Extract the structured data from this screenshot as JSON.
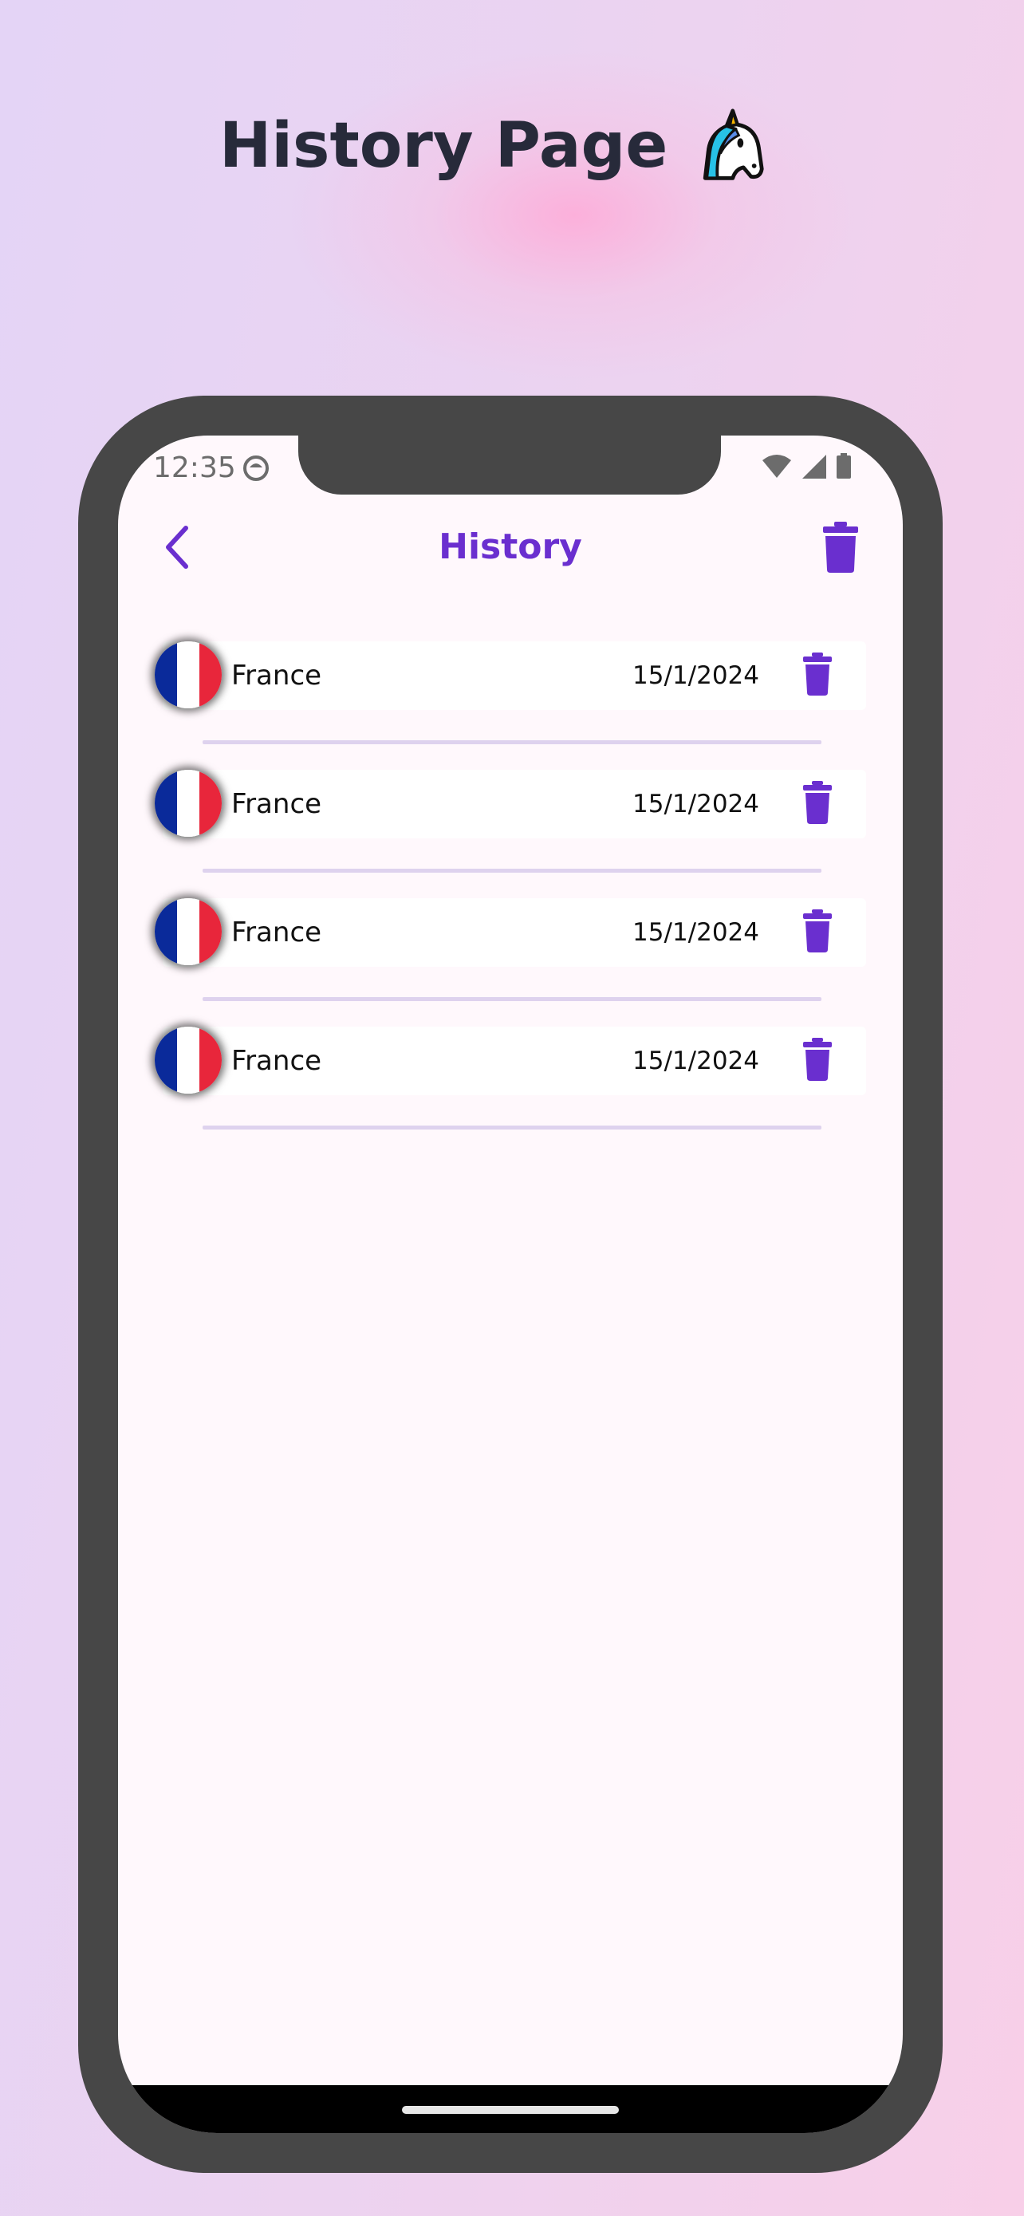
{
  "headline": {
    "text": "History Page",
    "emoji_icon": "unicorn-icon"
  },
  "status_bar": {
    "time": "12:35"
  },
  "app_bar": {
    "title": "History",
    "back_icon": "chevron-left-icon",
    "clear_icon": "trash-icon"
  },
  "colors": {
    "accent": "#6a2fcf",
    "frame": "#474747",
    "screen_bg": "#fff8fc",
    "divider": "#ded2ee"
  },
  "history": [
    {
      "country": "France",
      "date": "15/1/2024",
      "flag": [
        "#0a2a9a",
        "#ffffff",
        "#e8263b"
      ]
    },
    {
      "country": "France",
      "date": "15/1/2024",
      "flag": [
        "#0a2a9a",
        "#ffffff",
        "#e8263b"
      ]
    },
    {
      "country": "France",
      "date": "15/1/2024",
      "flag": [
        "#0a2a9a",
        "#ffffff",
        "#e8263b"
      ]
    },
    {
      "country": "France",
      "date": "15/1/2024",
      "flag": [
        "#0a2a9a",
        "#ffffff",
        "#e8263b"
      ]
    }
  ]
}
